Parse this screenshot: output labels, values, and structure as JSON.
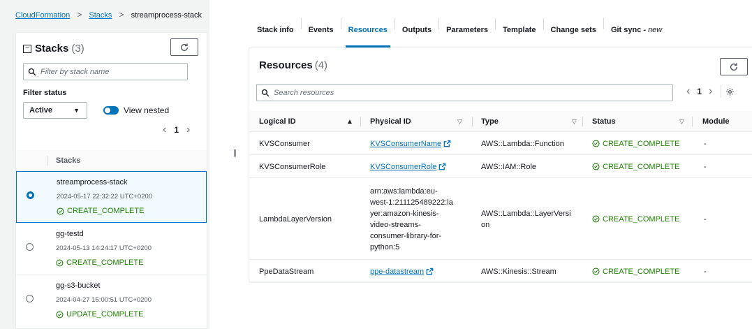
{
  "breadcrumb": {
    "root": "CloudFormation",
    "stacks": "Stacks",
    "current": "streamprocess-stack"
  },
  "stacks_panel": {
    "title": "Stacks",
    "count": "(3)",
    "filter_placeholder": "Filter by stack name",
    "filter_status_label": "Filter status",
    "status_select": "Active",
    "view_nested_label": "View nested",
    "page": "1",
    "column_header": "Stacks",
    "stacks": [
      {
        "name": "streamprocess-stack",
        "time": "2024-05-17 22:32:22 UTC+0200",
        "status": "CREATE_COMPLETE",
        "selected": true
      },
      {
        "name": "gg-testd",
        "time": "2024-05-13 14:24:17 UTC+0200",
        "status": "CREATE_COMPLETE",
        "selected": false
      },
      {
        "name": "gg-s3-bucket",
        "time": "2024-04-27 15:00:51 UTC+0200",
        "status": "UPDATE_COMPLETE",
        "selected": false
      }
    ]
  },
  "tabs": {
    "stack_info": "Stack info",
    "events": "Events",
    "resources": "Resources",
    "outputs": "Outputs",
    "parameters": "Parameters",
    "template": "Template",
    "change_sets": "Change sets",
    "git_sync": "Git sync -",
    "git_sync_badge": "new"
  },
  "resources": {
    "title": "Resources",
    "count": "(4)",
    "search_placeholder": "Search resources",
    "page": "1",
    "columns": {
      "logical_id": "Logical ID",
      "physical_id": "Physical ID",
      "type": "Type",
      "status": "Status",
      "module": "Module"
    },
    "rows": [
      {
        "logical_id": "KVSConsumer",
        "physical_id": "KVSConsumerName",
        "physical_is_link": true,
        "type": "AWS::Lambda::Function",
        "status": "CREATE_COMPLETE",
        "module": "-"
      },
      {
        "logical_id": "KVSConsumerRole",
        "physical_id": "KVSConsumerRole",
        "physical_is_link": true,
        "type": "AWS::IAM::Role",
        "status": "CREATE_COMPLETE",
        "module": "-"
      },
      {
        "logical_id": "LambdaLayerVersion",
        "physical_id": "arn:aws:lambda:eu-west-1:211125489222:layer:amazon-kinesis-video-streams-consumer-library-for-python:5",
        "physical_lines": [
          "arn:aws:lambda:eu-",
          "west-1:211125489222:la",
          "yer:amazon-kinesis-",
          "video-streams-",
          "consumer-library-for-",
          "python:5"
        ],
        "physical_is_link": false,
        "type_lines": [
          "AWS::Lambda::LayerVersi",
          "on"
        ],
        "type": "AWS::Lambda::LayerVersion",
        "status": "CREATE_COMPLETE",
        "module": "-"
      },
      {
        "logical_id": "PpeDataStream",
        "physical_id": "ppe-datastream",
        "physical_is_link": true,
        "type": "AWS::Kinesis::Stream",
        "status": "CREATE_COMPLETE",
        "module": "-"
      }
    ]
  },
  "colors": {
    "link": "#0073bb",
    "success": "#1d8102",
    "panel_bg": "#f2f3f3"
  }
}
